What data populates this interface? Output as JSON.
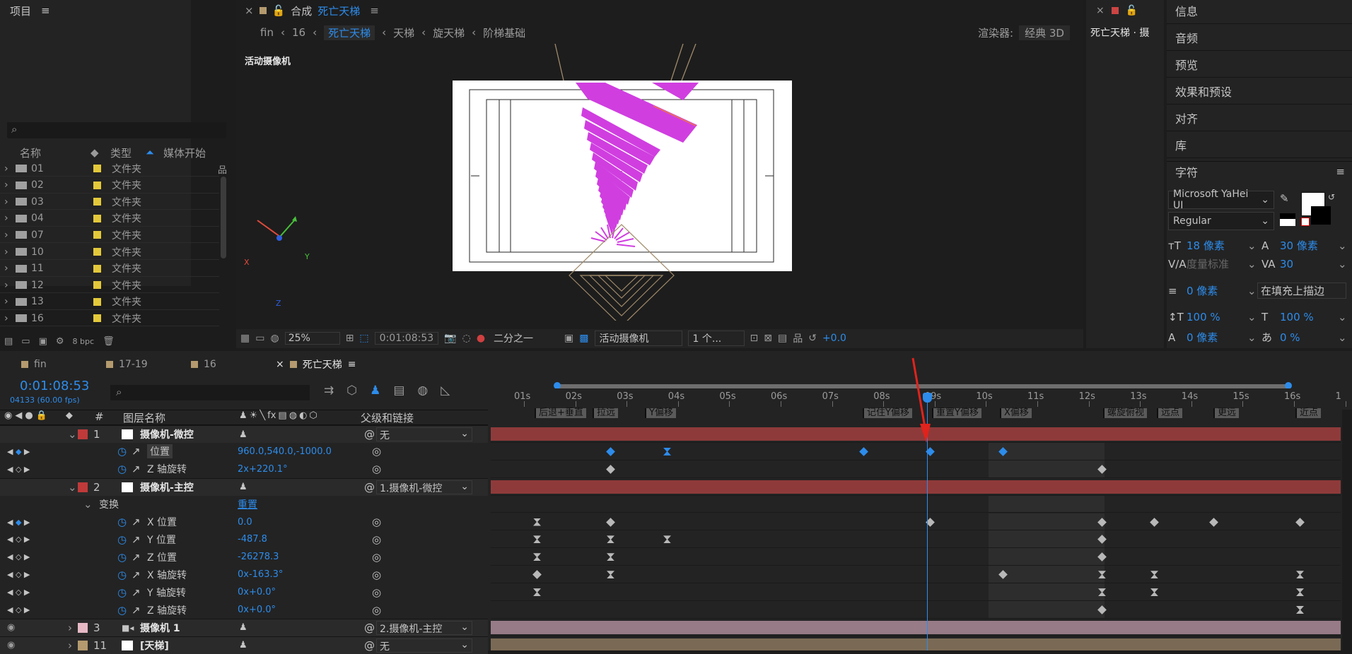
{
  "project": {
    "title": "项目",
    "menu_icon": "hamburger-icon",
    "search_placeholder": "",
    "col_name": "名称",
    "col_type": "类型",
    "col_media_start": "媒体开始",
    "col_trunc": "媒",
    "folders": [
      {
        "name": "01",
        "type": "文件夹"
      },
      {
        "name": "02",
        "type": "文件夹"
      },
      {
        "name": "03",
        "type": "文件夹"
      },
      {
        "name": "04",
        "type": "文件夹"
      },
      {
        "name": "07",
        "type": "文件夹"
      },
      {
        "name": "10",
        "type": "文件夹"
      },
      {
        "name": "11",
        "type": "文件夹"
      },
      {
        "name": "12",
        "type": "文件夹"
      },
      {
        "name": "13",
        "type": "文件夹"
      },
      {
        "name": "16",
        "type": "文件夹"
      }
    ],
    "bpc": "8 bpc"
  },
  "comp": {
    "tab_prefix": "合成",
    "tab_name": "死亡天梯",
    "breadcrumbs": [
      "fin",
      "16",
      "死亡天梯",
      "天梯",
      "旋天梯",
      "阶梯基础"
    ],
    "renderer_label": "渲染器:",
    "renderer_value": "经典 3D",
    "camera_label": "活动摄像机",
    "zoom": "25%",
    "timecode": "0:01:08:53",
    "resolution": "二分之一",
    "view": "活动摄像机",
    "views_count": "1 个...",
    "exposure": "+0.0",
    "axis_x": "X",
    "axis_y": "Y",
    "axis_z": "Z"
  },
  "right_top": {
    "tab_label": "死亡天梯 · 摄"
  },
  "side_menu": [
    "信息",
    "音频",
    "预览",
    "效果和预设",
    "对齐",
    "库"
  ],
  "character": {
    "title": "字符",
    "font": "Microsoft YaHei UI",
    "style": "Regular",
    "size": "18 像素",
    "leading": "30 像素",
    "kerning": "度量标准",
    "tracking": "30",
    "stroke_width": "0 像素",
    "stroke_mode": "在填充上描边",
    "vscale": "100 %",
    "hscale": "100 %",
    "baseline": "0 像素",
    "tsume": "0 %",
    "fill_color": "#ffffff",
    "stroke_color": "#000000"
  },
  "timeline": {
    "tabs": [
      "fin",
      "17-19",
      "16",
      "死亡天梯"
    ],
    "timecode": "0:01:08:53",
    "frames": "04133 (60.00 fps)",
    "col_num": "#",
    "col_layer": "图层名称",
    "col_parent": "父级和链接",
    "ruler": [
      "01s",
      "02s",
      "03s",
      "04s",
      "05s",
      "06s",
      "07s",
      "08s",
      "09s",
      "10s",
      "11s",
      "12s",
      "13s",
      "14s",
      "15s",
      "16s",
      "1"
    ],
    "markers": [
      "后退+垂直",
      "拉远",
      "Y偏移",
      "记住Y偏移",
      "重置Y偏移",
      "X偏移",
      "螺旋俯视",
      "远点",
      "更远",
      "近点"
    ],
    "layers": [
      {
        "num": "1",
        "name": "摄像机-微控",
        "parent": "无"
      },
      {
        "prop": "位置",
        "value": "960.0,540.0,-1000.0"
      },
      {
        "prop": "Z 轴旋转",
        "value": "2x+220.1°"
      },
      {
        "num": "2",
        "name": "摄像机-主控",
        "parent": "1.摄像机-微控"
      },
      {
        "group": "变换",
        "reset": "重置"
      },
      {
        "prop": "X 位置",
        "value": "0.0"
      },
      {
        "prop": "Y 位置",
        "value": "-487.8"
      },
      {
        "prop": "Z 位置",
        "value": "-26278.3"
      },
      {
        "prop": "X 轴旋转",
        "value": "0x-163.3°"
      },
      {
        "prop": "Y 轴旋转",
        "value": "0x+0.0°"
      },
      {
        "prop": "Z 轴旋转",
        "value": "0x+0.0°"
      },
      {
        "num": "3",
        "name": "摄像机 1",
        "parent": "2.摄像机-主控"
      },
      {
        "num": "11",
        "name": "[天梯]",
        "parent": "无"
      }
    ]
  }
}
